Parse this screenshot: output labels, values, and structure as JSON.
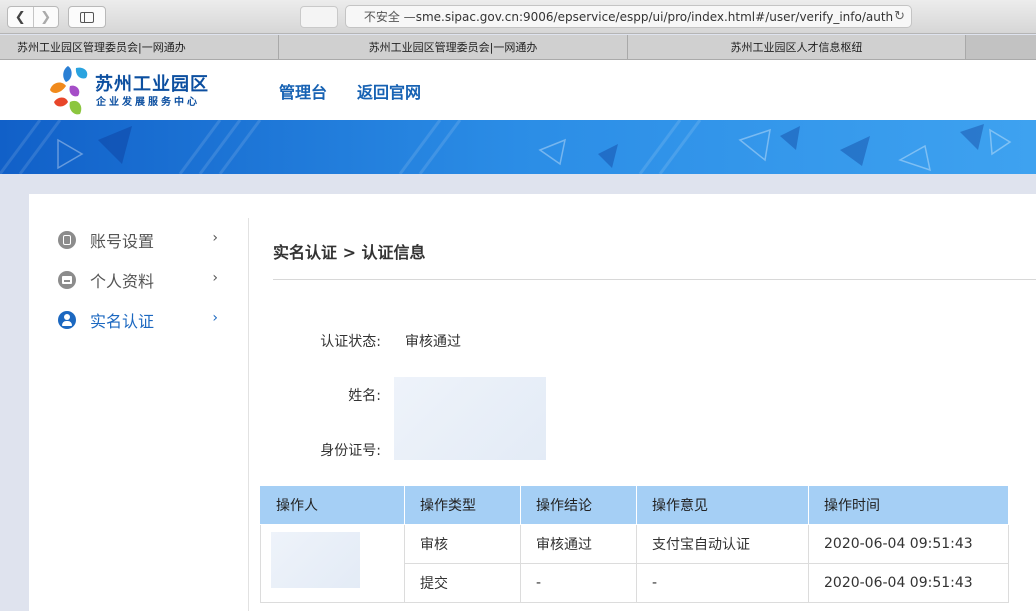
{
  "browser": {
    "address_warning": "不安全 —",
    "address_url": " sme.sipac.gov.cn:9006/epservice/espp/ui/pro/index.html#/user/verify_info/auth"
  },
  "tabs": [
    {
      "label": "苏州工业园区管理委员会|一网通办"
    },
    {
      "label": "苏州工业园区管理委员会|一网通办"
    },
    {
      "label": "苏州工业园区人才信息枢纽"
    }
  ],
  "site": {
    "logo_title": "苏州工业园区",
    "logo_subtitle": "企业发展服务中心",
    "nav": [
      {
        "label": "管理台"
      },
      {
        "label": "返回官网"
      }
    ]
  },
  "sidebar": {
    "items": [
      {
        "label": "账号设置",
        "icon": "phone-icon",
        "active": false
      },
      {
        "label": "个人资料",
        "icon": "id-card-icon",
        "active": false
      },
      {
        "label": "实名认证",
        "icon": "user-icon",
        "active": true
      }
    ],
    "chevron": "›"
  },
  "main": {
    "breadcrumb": "实名认证 > 认证信息",
    "fields": {
      "status_label": "认证状态:",
      "status_value": "审核通过",
      "name_label": "姓名:",
      "id_label": "身份证号:"
    },
    "table": {
      "headers": [
        "操作人",
        "操作类型",
        "操作结论",
        "操作意见",
        "操作时间"
      ],
      "rows": [
        [
          "",
          "审核",
          "审核通过",
          "支付宝自动认证",
          "2020-06-04 09:51:43"
        ],
        [
          "",
          "提交",
          "-",
          "-",
          "2020-06-04 09:51:43"
        ]
      ]
    }
  },
  "colors": {
    "accent": "#1c68c0",
    "table_header": "#a5cff5",
    "banner": "#2b8de6"
  }
}
